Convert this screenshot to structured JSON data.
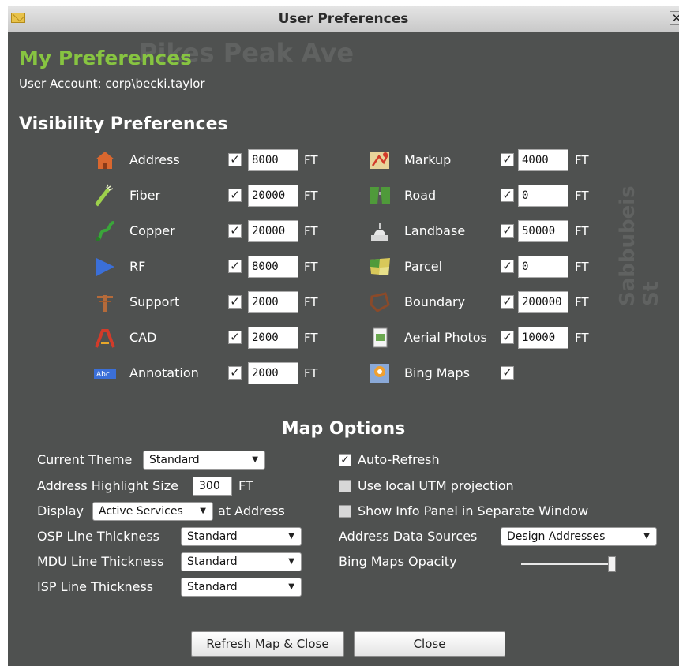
{
  "window": {
    "title": "User Preferences"
  },
  "header": {
    "my_prefs": "My Preferences",
    "account": "User Account: corp\\becki.taylor"
  },
  "visibility": {
    "heading": "Visibility Preferences",
    "unit": "FT",
    "left": [
      {
        "name": "Address",
        "checked": true,
        "value": "8000",
        "icon": "house-icon"
      },
      {
        "name": "Fiber",
        "checked": true,
        "value": "20000",
        "icon": "fiber-icon"
      },
      {
        "name": "Copper",
        "checked": true,
        "value": "20000",
        "icon": "copper-wire-icon"
      },
      {
        "name": "RF",
        "checked": true,
        "value": "8000",
        "icon": "rf-triangle-icon"
      },
      {
        "name": "Support",
        "checked": true,
        "value": "2000",
        "icon": "pole-icon"
      },
      {
        "name": "CAD",
        "checked": true,
        "value": "2000",
        "icon": "cad-icon"
      },
      {
        "name": "Annotation",
        "checked": true,
        "value": "2000",
        "icon": "annotation-icon"
      }
    ],
    "right": [
      {
        "name": "Markup",
        "checked": true,
        "value": "4000",
        "icon": "markup-icon"
      },
      {
        "name": "Road",
        "checked": true,
        "value": "0",
        "icon": "road-icon"
      },
      {
        "name": "Landbase",
        "checked": true,
        "value": "50000",
        "icon": "capitol-icon"
      },
      {
        "name": "Parcel",
        "checked": true,
        "value": "0",
        "icon": "parcel-icon"
      },
      {
        "name": "Boundary",
        "checked": true,
        "value": "200000",
        "icon": "boundary-icon"
      },
      {
        "name": "Aerial Photos",
        "checked": true,
        "value": "10000",
        "icon": "aerial-photo-icon"
      },
      {
        "name": "Bing Maps",
        "checked": true,
        "value": null,
        "icon": "bing-maps-icon"
      }
    ]
  },
  "map_options": {
    "heading": "Map Options",
    "current_theme_label": "Current Theme",
    "current_theme_value": "Standard",
    "address_highlight_label": "Address Highlight Size",
    "address_highlight_value": "300",
    "address_highlight_unit": "FT",
    "display_label": "Display",
    "display_value": "Active Services",
    "display_suffix": "at Address",
    "osp_label": "OSP Line Thickness",
    "osp_value": "Standard",
    "mdu_label": "MDU Line Thickness",
    "mdu_value": "Standard",
    "isp_label": "ISP Line Thickness",
    "isp_value": "Standard",
    "auto_refresh_label": "Auto-Refresh",
    "auto_refresh_checked": true,
    "utm_label": "Use local UTM projection",
    "utm_checked": false,
    "info_panel_label": "Show Info Panel in Separate Window",
    "info_panel_checked": false,
    "address_sources_label": "Address Data Sources",
    "address_sources_value": "Design Addresses",
    "bing_opacity_label": "Bing Maps Opacity",
    "bing_opacity_level": 1.0
  },
  "buttons": {
    "refresh_close": "Refresh Map & Close",
    "close": "Close"
  },
  "background": {
    "text1": "Pikes Peak Ave",
    "text2": "Sabbubeis St"
  },
  "colors": {
    "green_heading": "#87c441",
    "panel": "#4f5150"
  }
}
